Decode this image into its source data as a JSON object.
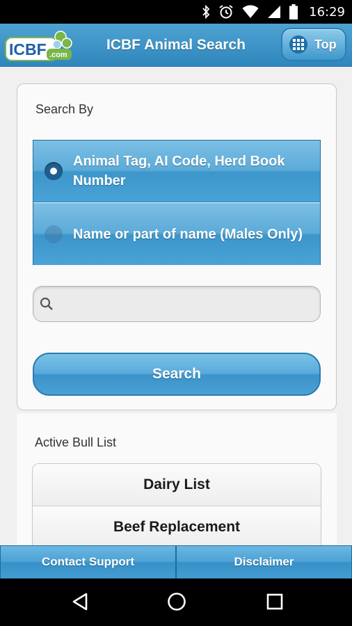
{
  "status_bar": {
    "time": "16:29",
    "icons": [
      "bluetooth-icon",
      "alarm-icon",
      "wifi-icon",
      "signal-icon",
      "battery-icon"
    ]
  },
  "header": {
    "logo_text": "ICBF",
    "logo_suffix": ".com",
    "title": "ICBF Animal Search",
    "top_button_label": "Top"
  },
  "search": {
    "section_label": "Search By",
    "options": [
      {
        "label": "Animal Tag, AI Code, Herd Book Number",
        "selected": true
      },
      {
        "label": "Name or part of name (Males Only)",
        "selected": false
      }
    ],
    "input_value": "",
    "input_placeholder": "",
    "button_label": "Search"
  },
  "bull_list": {
    "section_label": "Active Bull List",
    "items": [
      "Dairy List",
      "Beef Replacement"
    ]
  },
  "bottom_bar": {
    "contact_label": "Contact Support",
    "disclaimer_label": "Disclaimer"
  },
  "colors": {
    "header_blue": "#3a8fc4",
    "button_blue": "#4aa0d5",
    "logo_blue": "#1f5fa8",
    "logo_green": "#7ab648"
  }
}
